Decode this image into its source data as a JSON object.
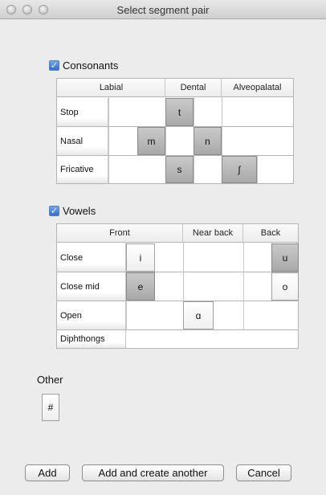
{
  "window": {
    "title": "Select segment pair"
  },
  "consonants": {
    "label": "Consonants",
    "checked": "✓",
    "columns": [
      "Labial",
      "Dental",
      "Alveopalatal"
    ],
    "rows": [
      "Stop",
      "Nasal",
      "Fricative"
    ],
    "segments": {
      "t": "t",
      "m": "m",
      "n": "n",
      "s": "s",
      "esh": "ʃ"
    }
  },
  "vowels": {
    "label": "Vowels",
    "checked": "✓",
    "columns": [
      "Front",
      "Near back",
      "Back"
    ],
    "rows": [
      "Close",
      "Close mid",
      "Open",
      "Diphthongs"
    ],
    "segments": {
      "i": "i",
      "u": "u",
      "e": "e",
      "o": "o",
      "a": "ɑ"
    }
  },
  "other": {
    "label": "Other",
    "segment": "#"
  },
  "buttons": {
    "add": "Add",
    "add_another": "Add and create another",
    "cancel": "Cancel"
  }
}
